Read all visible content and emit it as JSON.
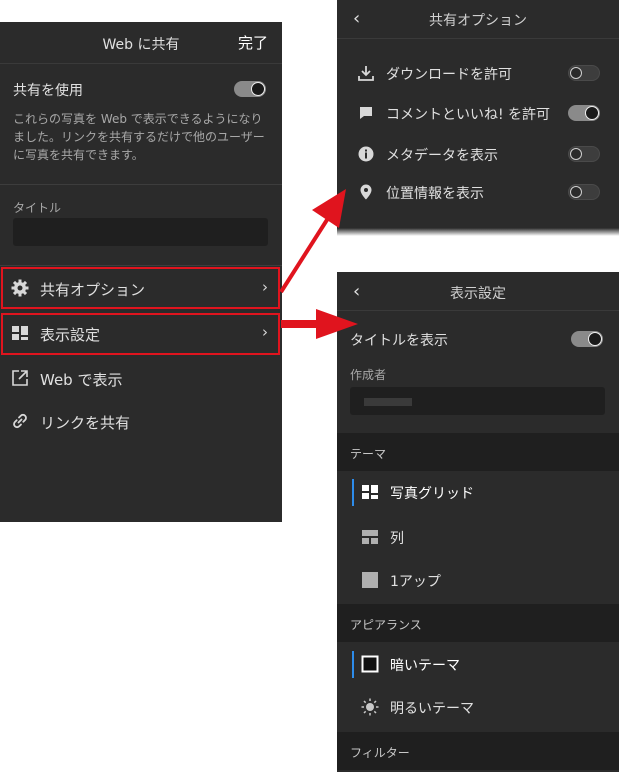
{
  "left_panel": {
    "title": "Web に共有",
    "done_label": "完了",
    "share_toggle_label": "共有を使用",
    "share_toggle_state": "on",
    "description": "これらの写真を Web で表示できるようになりました。リンクを共有するだけで他のユーザーに写真を共有できます。",
    "title_field_label": "タイトル",
    "title_field_value": "",
    "menu": [
      {
        "label": "共有オプション",
        "icon": "gear-icon",
        "chevron": "›"
      },
      {
        "label": "表示設定",
        "icon": "layout-icon",
        "chevron": "›"
      },
      {
        "label": "Web で表示",
        "icon": "external-link-icon"
      },
      {
        "label": "リンクを共有",
        "icon": "link-icon"
      }
    ]
  },
  "share_options_panel": {
    "back_label": "‹",
    "title": "共有オプション",
    "options": [
      {
        "label": "ダウンロードを許可",
        "icon": "download-icon",
        "state": "off"
      },
      {
        "label": "コメントといいね! を許可",
        "icon": "comment-icon",
        "state": "on"
      },
      {
        "label": "メタデータを表示",
        "icon": "info-icon",
        "state": "off"
      },
      {
        "label": "位置情報を表示",
        "icon": "location-pin-icon",
        "state": "off"
      }
    ]
  },
  "display_settings_panel": {
    "back_label": "‹",
    "title": "表示設定",
    "show_title_label": "タイトルを表示",
    "show_title_state": "on",
    "author_label": "作成者",
    "author_value": "",
    "theme_section": "テーマ",
    "themes": [
      {
        "label": "写真グリッド",
        "icon": "photo-grid-icon",
        "selected": true
      },
      {
        "label": "列",
        "icon": "columns-icon",
        "selected": false
      },
      {
        "label": "1アップ",
        "icon": "one-up-icon",
        "selected": false
      }
    ],
    "appearance_section": "アピアランス",
    "appearances": [
      {
        "label": "暗いテーマ",
        "icon": "dark-theme-icon",
        "selected": true
      },
      {
        "label": "明るいテーマ",
        "icon": "sun-icon",
        "selected": false
      }
    ],
    "filter_section": "フィルター"
  },
  "colors": {
    "panel_bg": "#2b2b2b",
    "highlight_red": "#e0141e",
    "selection_blue": "#2d8ceb"
  }
}
